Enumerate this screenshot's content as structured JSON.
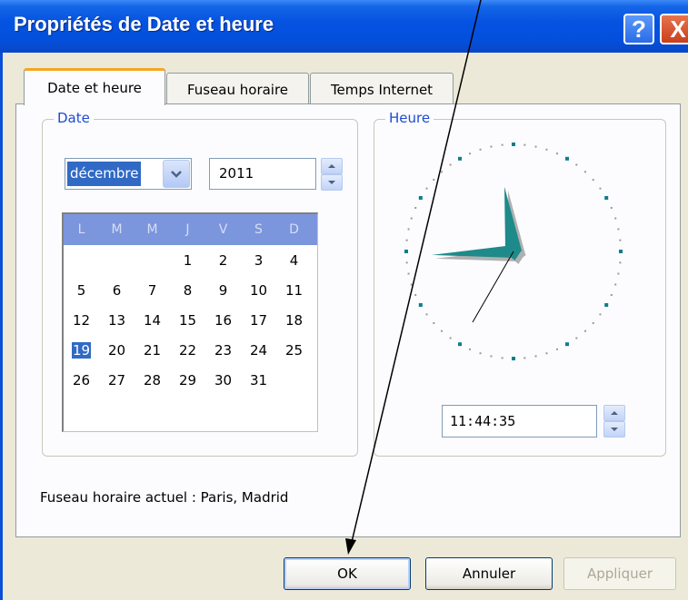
{
  "window": {
    "title": "Propriétés de Date et heure",
    "help_label": "?",
    "close_label": "X"
  },
  "tabs": [
    {
      "label": "Date et heure",
      "active": true
    },
    {
      "label": "Fuseau horaire",
      "active": false
    },
    {
      "label": "Temps Internet",
      "active": false
    }
  ],
  "date_group": {
    "label": "Date",
    "month": "décembre",
    "year": "2011",
    "weekday_headers": [
      "L",
      "M",
      "M",
      "J",
      "V",
      "S",
      "D"
    ],
    "days": [
      "",
      "",
      "",
      "1",
      "2",
      "3",
      "4",
      "5",
      "6",
      "7",
      "8",
      "9",
      "10",
      "11",
      "12",
      "13",
      "14",
      "15",
      "16",
      "17",
      "18",
      "19",
      "20",
      "21",
      "22",
      "23",
      "24",
      "25",
      "26",
      "27",
      "28",
      "29",
      "30",
      "31"
    ],
    "selected_day": "19"
  },
  "time_group": {
    "label": "Heure",
    "time": "11:44:35",
    "hour": 11,
    "minute": 44,
    "second": 35
  },
  "timezone_text": "Fuseau horaire actuel : Paris, Madrid",
  "buttons": {
    "ok": "OK",
    "cancel": "Annuler",
    "apply": "Appliquer"
  },
  "colors": {
    "titlebar": "#0553e1",
    "selection": "#316ac5",
    "group_label": "#1d4bd1",
    "clock_hand": "#1e8a8a"
  }
}
